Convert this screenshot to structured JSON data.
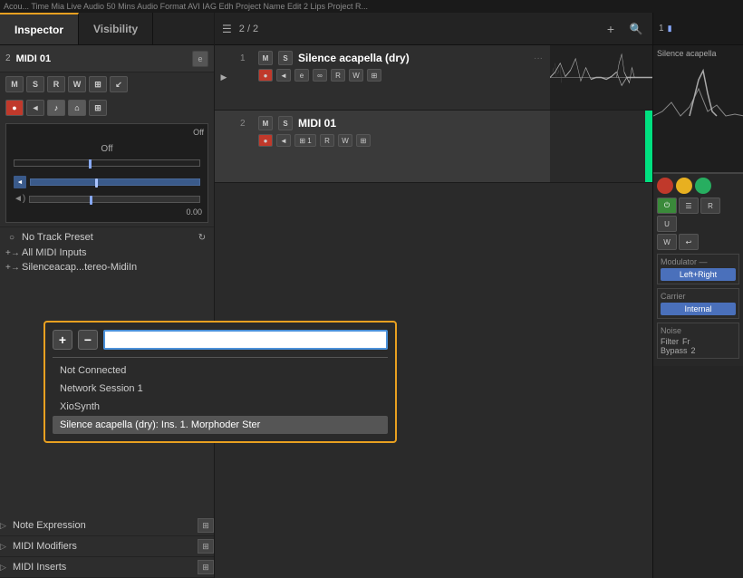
{
  "topbar": {
    "text": "Acou... Time Mia   Live Audio 50 Mins   Audio Format   AVI IAG Edh   Project Name Edit   2 Lips   Project R..."
  },
  "tabs": {
    "inspector": "Inspector",
    "visibility": "Visibility"
  },
  "track": {
    "number": "2",
    "name": "MIDI 01",
    "editBtn": "e"
  },
  "controls": {
    "m": "M",
    "s": "S",
    "r": "R",
    "w": "W",
    "buttons": [
      "M",
      "S",
      "R",
      "W",
      "⊞",
      "↙"
    ],
    "row2": [
      "●",
      "◄",
      "♪",
      "⌂",
      "⊞"
    ]
  },
  "volpan": {
    "offLabel": "Off",
    "panLabel": "Off",
    "value": "0.00"
  },
  "preset": {
    "icon": "○",
    "label": "No Track Preset",
    "refreshIcon": "↻",
    "inputsIcon": "+",
    "allMidiInputs": "All MIDI Inputs",
    "silenceInput": "Silenceacap...tereo-MidiIn"
  },
  "dropdown": {
    "addBtn": "+",
    "removeBtn": "−",
    "searchPlaceholder": "",
    "items": [
      {
        "label": "Not Connected",
        "selected": false
      },
      {
        "label": "Network Session 1",
        "selected": false
      },
      {
        "label": "XioSynth",
        "selected": false
      },
      {
        "label": "Silence acapella (dry): Ins. 1. Morphoder Ster",
        "selected": true
      }
    ]
  },
  "centerPanel": {
    "listIcon": "☰",
    "trackCount": "2 / 2",
    "addBtn": "+",
    "searchBtn": "🔍",
    "tracks": [
      {
        "number": "1",
        "type": "audio",
        "name": "Silence acapella (dry)",
        "controls": [
          "●",
          "◄",
          "e",
          "∞",
          "R",
          "W",
          "⊞"
        ],
        "hasDots": true
      },
      {
        "number": "2",
        "type": "midi",
        "name": "MIDI 01",
        "controls": [
          "●",
          "◄",
          "⊞",
          "1",
          "R",
          "W",
          "⊞"
        ],
        "hasDots": false
      }
    ]
  },
  "rightPanel": {
    "trackNumber": "1",
    "trackName": "Silence acapella"
  },
  "rightInstrument": {
    "buttons": [
      "●",
      "☰",
      "R",
      "U"
    ],
    "row2": [
      "W",
      "↩"
    ],
    "modulator": {
      "title": "Modulator —",
      "value": "Left+Right"
    },
    "carrier": {
      "title": "Carrier",
      "value": "Internal"
    },
    "noise": {
      "title": "Noise",
      "filterLabel": "Filter",
      "filterVal": "Fr",
      "bypassLabel": "Bypass",
      "bypassVal": "2"
    }
  },
  "bottomSections": [
    {
      "name": "Note Expression",
      "icon": "▷",
      "rightIcon": "⊞"
    },
    {
      "name": "MIDI Modifiers",
      "icon": "▷",
      "rightIcon": "⊞"
    },
    {
      "name": "MIDI Inserts",
      "icon": "▷",
      "rightIcon": "⊞"
    }
  ]
}
